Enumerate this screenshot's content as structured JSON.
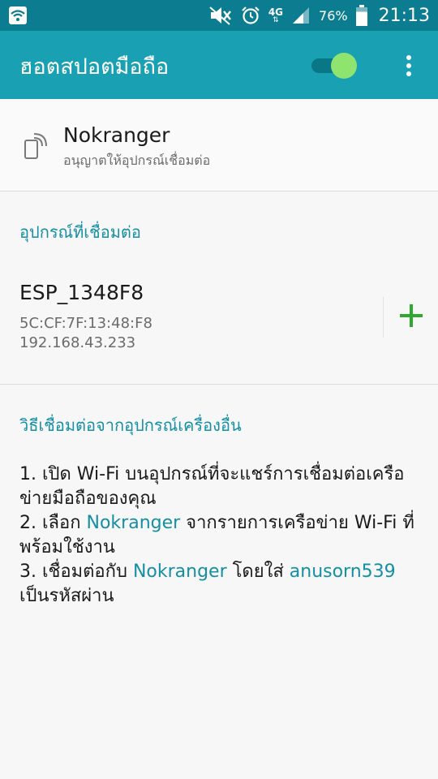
{
  "status_bar": {
    "icons": [
      "wifi-icon",
      "mute-icon",
      "alarm-icon",
      "signal-icon",
      "battery-icon"
    ],
    "network_type": "4G",
    "battery": "76%",
    "time": "21:13"
  },
  "app_bar": {
    "title": "ฮอตสปอตมือถือ",
    "toggle_on": true,
    "menu_icon": "more-vert-icon"
  },
  "network": {
    "icon": "hotspot-device-icon",
    "name": "Nokranger",
    "subtitle": "อนุญาตให้อุปกรณ์เชื่อมต่อ"
  },
  "connected_section": {
    "header": "อุปกรณ์ที่เชื่อมต่อ",
    "devices": [
      {
        "name": "ESP_1348F8",
        "mac": "5C:CF:7F:13:48:F8",
        "ip": "192.168.43.233",
        "action_icon": "add-icon"
      }
    ]
  },
  "instructions": {
    "header": "วิธีเชื่อมต่อจากอุปกรณ์เครื่องอื่น",
    "step1": "1. เปิด Wi-Fi บนอุปกรณ์ที่จะแชร์การเชื่อมต่อเครือข่ายมือถือของคุณ",
    "step2_prefix": "2. เลือก ",
    "step2_network": "Nokranger",
    "step2_suffix": " จากรายการเครือข่าย Wi-Fi ที่พร้อมใช้งาน",
    "step3_prefix": "3. เชื่อมต่อกับ ",
    "step3_network": "Nokranger",
    "step3_middle": " โดยใส่ ",
    "step3_password": "anusorn539",
    "step3_suffix": " เป็นรหัสผ่าน"
  },
  "colors": {
    "status_bar": "#0c7d91",
    "app_bar": "#19a0b3",
    "accent": "#148fa5",
    "toggle_knob": "#8fe36f",
    "add_green": "#2ea82e"
  }
}
